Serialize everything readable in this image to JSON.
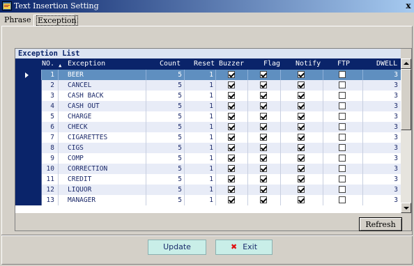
{
  "window": {
    "title": "Text Insertion Setting",
    "close_glyph": "x"
  },
  "tabs": [
    {
      "label": "Phrase"
    },
    {
      "label": "Exception"
    }
  ],
  "grid": {
    "caption": "Exception List",
    "headers": {
      "no": "NO.",
      "sort_glyph": "▲",
      "exception": "Exception",
      "count": "Count",
      "reset": "Reset",
      "buzzer": "Buzzer",
      "flag": "Flag",
      "notify": "Notify",
      "ftp": "FTP",
      "dwell": "DWELL"
    },
    "rows": [
      {
        "no": "1",
        "exception": "BEER",
        "count": "5",
        "reset": "1",
        "buzzer": true,
        "flag": true,
        "notify": true,
        "ftp": false,
        "dwell": "3"
      },
      {
        "no": "2",
        "exception": "CANCEL",
        "count": "5",
        "reset": "1",
        "buzzer": true,
        "flag": true,
        "notify": true,
        "ftp": false,
        "dwell": "3"
      },
      {
        "no": "3",
        "exception": "CASH BACK",
        "count": "5",
        "reset": "1",
        "buzzer": true,
        "flag": true,
        "notify": true,
        "ftp": false,
        "dwell": "3"
      },
      {
        "no": "4",
        "exception": "CASH OUT",
        "count": "5",
        "reset": "1",
        "buzzer": true,
        "flag": true,
        "notify": true,
        "ftp": false,
        "dwell": "3"
      },
      {
        "no": "5",
        "exception": "CHARGE",
        "count": "5",
        "reset": "1",
        "buzzer": true,
        "flag": true,
        "notify": true,
        "ftp": false,
        "dwell": "3"
      },
      {
        "no": "6",
        "exception": "CHECK",
        "count": "5",
        "reset": "1",
        "buzzer": true,
        "flag": true,
        "notify": true,
        "ftp": false,
        "dwell": "3"
      },
      {
        "no": "7",
        "exception": "CIGARETTES",
        "count": "5",
        "reset": "1",
        "buzzer": true,
        "flag": true,
        "notify": true,
        "ftp": false,
        "dwell": "3"
      },
      {
        "no": "8",
        "exception": "CIGS",
        "count": "5",
        "reset": "1",
        "buzzer": true,
        "flag": true,
        "notify": true,
        "ftp": false,
        "dwell": "3"
      },
      {
        "no": "9",
        "exception": "COMP",
        "count": "5",
        "reset": "1",
        "buzzer": true,
        "flag": true,
        "notify": true,
        "ftp": false,
        "dwell": "3"
      },
      {
        "no": "10",
        "exception": "CORRECTION",
        "count": "5",
        "reset": "1",
        "buzzer": true,
        "flag": true,
        "notify": true,
        "ftp": false,
        "dwell": "3"
      },
      {
        "no": "11",
        "exception": "CREDIT",
        "count": "5",
        "reset": "1",
        "buzzer": true,
        "flag": true,
        "notify": true,
        "ftp": false,
        "dwell": "3"
      },
      {
        "no": "12",
        "exception": "LIQUOR",
        "count": "5",
        "reset": "1",
        "buzzer": true,
        "flag": true,
        "notify": true,
        "ftp": false,
        "dwell": "3"
      },
      {
        "no": "13",
        "exception": "MANAGER",
        "count": "5",
        "reset": "1",
        "buzzer": true,
        "flag": true,
        "notify": true,
        "ftp": false,
        "dwell": "3"
      }
    ],
    "selected_row_no": "1"
  },
  "buttons": {
    "refresh": "Refresh",
    "update": "Update",
    "exit": "Exit",
    "exit_icon_glyph": "✖"
  },
  "colors": {
    "title_bar": "#0a246a",
    "header": "#0a246a",
    "selected_row": "#5f8fc0",
    "alt_row": "#e8ecf7",
    "button_face": "#c9eee8",
    "exit_icon": "#e01010"
  },
  "icons": {
    "app": "app-window-icon",
    "close": "close-icon",
    "row_pointer": "row-pointer-icon",
    "exit": "x-icon"
  }
}
